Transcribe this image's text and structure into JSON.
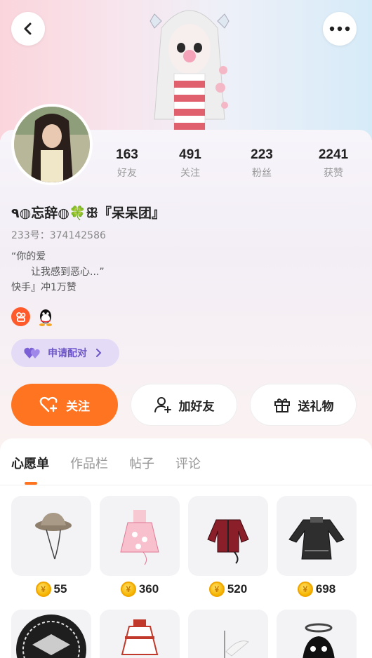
{
  "header": {
    "back_icon": "chevron-left-icon",
    "more_icon": "more-dots-icon"
  },
  "profile": {
    "name": "٩◍忘辞◍🍀ꕥ『呆呆团』",
    "uid": "233号：374142586",
    "bio_line1": "“你的爱",
    "bio_line2": "让我感到恶心...”",
    "bio_line3": "快手』冲1万赞"
  },
  "stats": [
    {
      "num": "163",
      "label": "好友"
    },
    {
      "num": "491",
      "label": "关注"
    },
    {
      "num": "223",
      "label": "粉丝"
    },
    {
      "num": "2241",
      "label": "获赞"
    }
  ],
  "pair_button": {
    "label": "申请配对"
  },
  "actions": {
    "follow": "关注",
    "add_friend": "加好友",
    "gift": "送礼物"
  },
  "tabs": [
    {
      "label": "心愿单",
      "active": true
    },
    {
      "label": "作品栏",
      "active": false
    },
    {
      "label": "帖子",
      "active": false
    },
    {
      "label": "评论",
      "active": false
    }
  ],
  "wishlist": [
    {
      "price": "55",
      "item": "hat"
    },
    {
      "price": "360",
      "item": "pink-dress"
    },
    {
      "price": "520",
      "item": "red-jacket"
    },
    {
      "price": "698",
      "item": "black-dress"
    },
    {
      "price": "",
      "item": "black-emblem"
    },
    {
      "price": "",
      "item": "maid-dress"
    },
    {
      "price": "",
      "item": "white-wings"
    },
    {
      "price": "",
      "item": "ghost-halo"
    }
  ],
  "colors": {
    "accent": "#ff7421",
    "pair_bg": "#e4dcf7",
    "pair_text": "#6e56c8"
  }
}
